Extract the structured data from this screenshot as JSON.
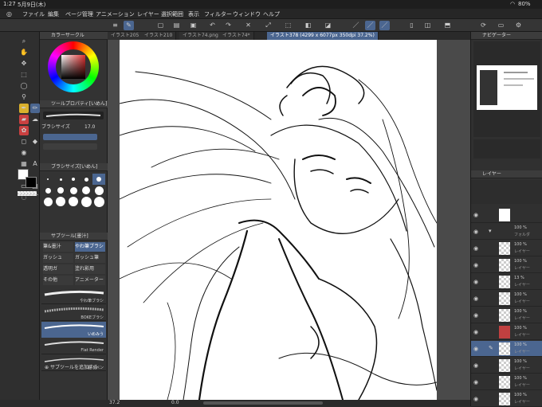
{
  "status": {
    "time": "1:27",
    "date": "5月9日(木)",
    "battery": "80%"
  },
  "menu": [
    "ファイル",
    "編集",
    "ページ管理",
    "アニメーション",
    "レイヤー",
    "選択範囲",
    "表示",
    "フィルター",
    "ウィンドウ",
    "ヘルプ"
  ],
  "panels": {
    "color": "カラーサークル",
    "tool_property": "ツールプロパティ[いめん]",
    "brush_size_label": "ブラシサイズ",
    "brush_size_value": "17.0",
    "brush_size_palette": "ブラシサイズ[いめん]",
    "brush_sizes": [
      "1",
      "2",
      "3",
      "4",
      "5",
      "6",
      "8",
      "10",
      "12",
      "15",
      "17",
      "20",
      "25",
      "30",
      "40",
      "50",
      "60",
      "70",
      "80",
      "100"
    ],
    "sub_tool_header": "サブツール[墨汁]",
    "sub_tool_groups": [
      "筆&墨汁",
      "やわ筆ブラシ",
      "ガッシュ",
      "ガッシュ筆",
      "透明ガ",
      "塗れ影用",
      "その他",
      "アニメーター"
    ],
    "brushes": [
      "やわ筆ブラシ",
      "BOKEブラシ",
      "いめみう",
      "Flat Render",
      "鉛るペン"
    ],
    "add_subtool": "サブツールを追加する"
  },
  "tabs": [
    "イラスト205",
    "イラスト210",
    "イラスト74.png",
    "イラスト74*",
    "イラスト378 (4299 x 6077px 350dpi 37.2%)"
  ],
  "navigator": {
    "title": "ナビゲーター",
    "zoom": "37.2",
    "angle": "0.0"
  },
  "layer_panel": {
    "title": "レイヤー",
    "folder": {
      "pct": "100 %",
      "name": "フォルダ"
    },
    "layers": [
      {
        "pct": "100 %",
        "name": "レイヤー"
      },
      {
        "pct": "100 %",
        "name": "レイヤー"
      },
      {
        "pct": "13 %",
        "name": "レイヤー"
      },
      {
        "pct": "100 %",
        "name": "レイヤー"
      },
      {
        "pct": "100 %",
        "name": "レイヤー"
      },
      {
        "pct": "100 %",
        "name": "レイヤー"
      },
      {
        "pct": "100 %",
        "name": "レイヤー"
      },
      {
        "pct": "100 %",
        "name": "レイヤー"
      },
      {
        "pct": "100 %",
        "name": "レイヤー"
      },
      {
        "pct": "100 %",
        "name": "レイヤー"
      }
    ]
  },
  "colors": {
    "accent": "#4b6690"
  }
}
